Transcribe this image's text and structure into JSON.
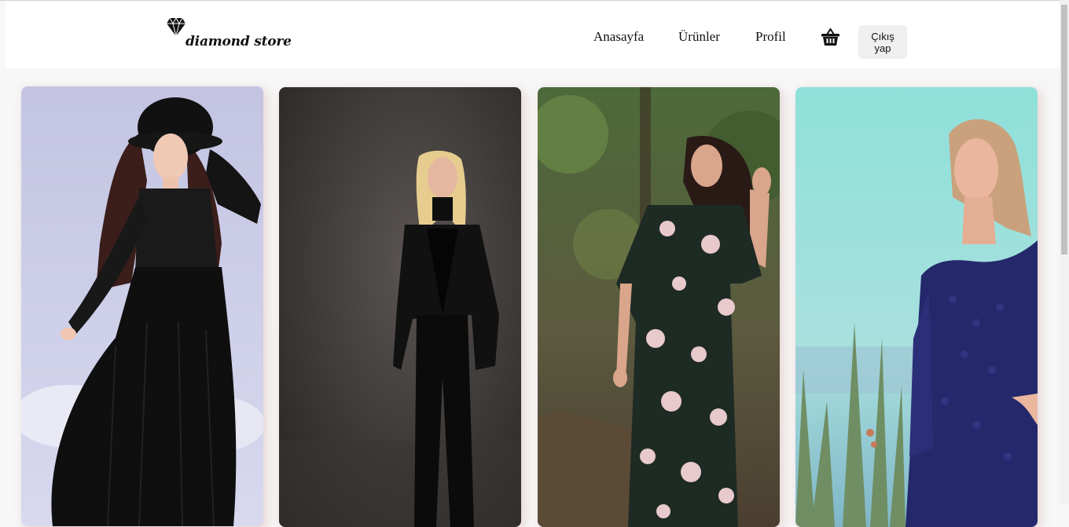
{
  "brand": {
    "name": "diamond store",
    "logo_icon": "diamond-icon"
  },
  "nav": {
    "links": [
      {
        "label": "Anasayfa"
      },
      {
        "label": "Ürünler"
      },
      {
        "label": "Profil"
      }
    ],
    "cart_icon": "shopping-basket-icon",
    "logout_label": "Çıkış yap"
  },
  "products": [
    {
      "image": "woman in black lace dress with black hat"
    },
    {
      "image": "woman in black suit"
    },
    {
      "image": "woman in floral maxi dress"
    },
    {
      "image": "woman in navy lace cut-out dress"
    }
  ]
}
